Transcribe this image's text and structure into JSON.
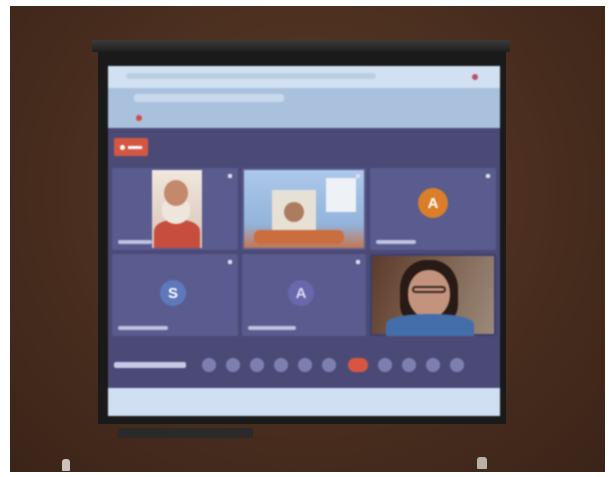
{
  "scene": {
    "description_kind": "photo of projected video-call screen",
    "colors": {
      "wall": "#4a2e1f",
      "projection_bg": "#4b4a7c",
      "tile": "#595b93",
      "recording_badge": "#e0543d",
      "end_call": "#e4533b",
      "avatar_orange": "#e37c1e",
      "avatar_blue": "#5c78c4",
      "avatar_purple": "#6a67b3"
    }
  },
  "participants": [
    {
      "kind": "video",
      "icon": "monk-video"
    },
    {
      "kind": "video",
      "icon": "stage-video"
    },
    {
      "kind": "avatar",
      "initial": "A"
    },
    {
      "kind": "avatar",
      "initial": "S"
    },
    {
      "kind": "avatar",
      "initial": "A"
    },
    {
      "kind": "video",
      "icon": "woman-video"
    }
  ],
  "controls": {
    "icons": [
      "mic-icon",
      "video-icon",
      "share-icon",
      "emoji-icon",
      "people-icon",
      "more-icon",
      "end-call-icon",
      "reactions-icon",
      "chat-icon",
      "participants-icon",
      "settings-icon"
    ]
  }
}
